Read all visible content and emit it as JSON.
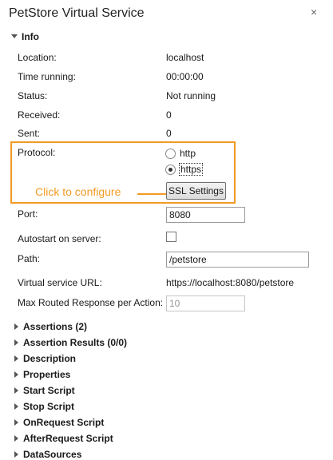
{
  "window": {
    "title": "PetStore Virtual Service",
    "close_glyph": "×"
  },
  "info": {
    "header": "Info",
    "location": {
      "label": "Location:",
      "value": "localhost"
    },
    "time_running": {
      "label": "Time running:",
      "value": "00:00:00"
    },
    "status": {
      "label": "Status:",
      "value": "Not running"
    },
    "received": {
      "label": "Received:",
      "value": "0"
    },
    "sent": {
      "label": "Sent:",
      "value": "0"
    },
    "protocol": {
      "label": "Protocol:",
      "options": [
        "http",
        "https"
      ],
      "selected": "https",
      "ssl_button": "SSL Settings"
    },
    "port": {
      "label": "Port:",
      "value": "8080"
    },
    "autostart": {
      "label": "Autostart on server:",
      "checked": false
    },
    "path": {
      "label": "Path:",
      "value": "/petstore"
    },
    "virtual_service_url": {
      "label": "Virtual service URL:",
      "value": "https://localhost:8080/petstore"
    },
    "max_routed": {
      "label": "Max Routed Response per Action:",
      "value": "10"
    }
  },
  "annotation": {
    "text": "Click to configure",
    "color": "#f29a24"
  },
  "sections": [
    "Assertions (2)",
    "Assertion Results (0/0)",
    "Description",
    "Properties",
    "Start Script",
    "Stop Script",
    "OnRequest Script",
    "AfterRequest Script",
    "DataSources"
  ]
}
